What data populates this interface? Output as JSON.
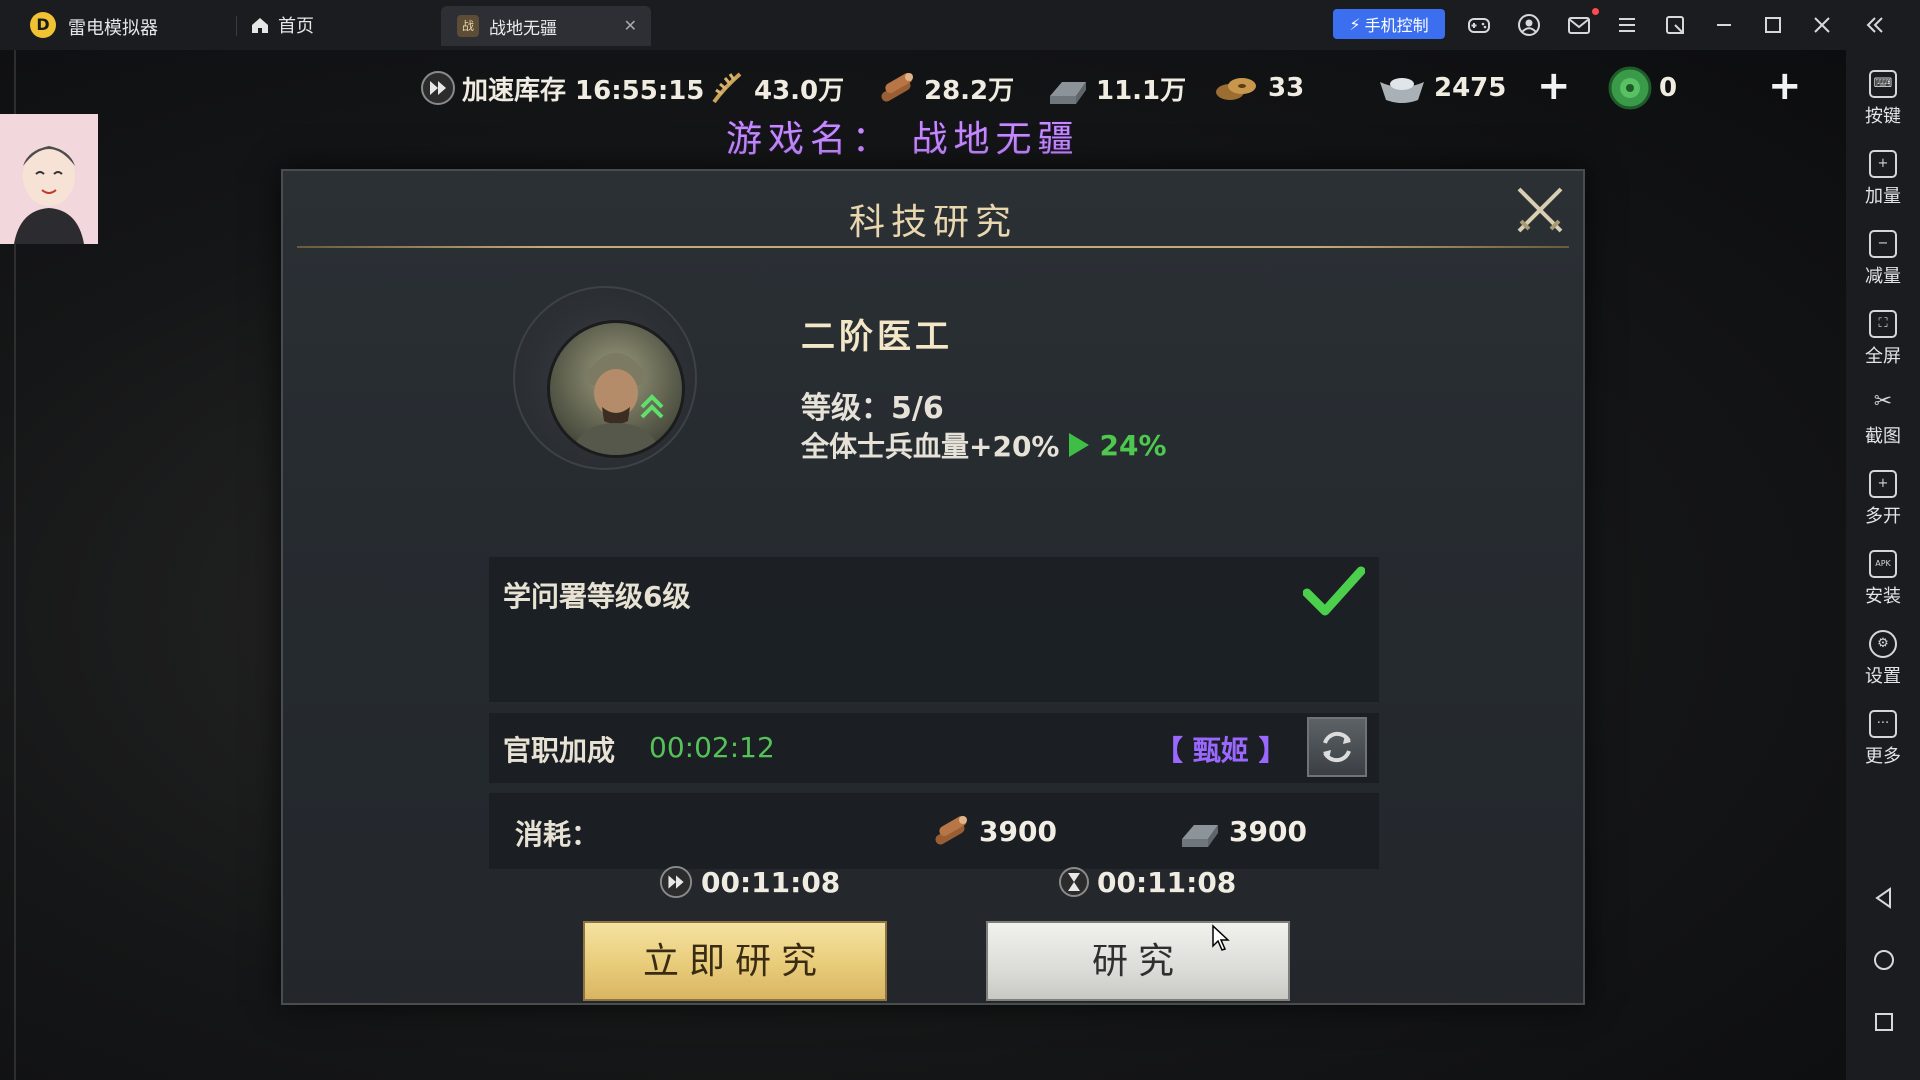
{
  "window": {
    "app_title": "雷电模拟器",
    "tabs": [
      {
        "label": "首页"
      },
      {
        "label": "战地无疆"
      }
    ],
    "phone_control_label": "手机控制"
  },
  "sidebar": {
    "items": [
      {
        "label": "按键",
        "icon": "keyboard-icon"
      },
      {
        "label": "加量",
        "icon": "volume-up-icon"
      },
      {
        "label": "减量",
        "icon": "volume-down-icon"
      },
      {
        "label": "全屏",
        "icon": "fullscreen-icon"
      },
      {
        "label": "截图",
        "icon": "scissors-icon"
      },
      {
        "label": "多开",
        "icon": "multi-instance-icon"
      },
      {
        "label": "安装",
        "icon": "apk-install-icon"
      },
      {
        "label": "设置",
        "icon": "settings-icon"
      },
      {
        "label": "更多",
        "icon": "more-icon"
      }
    ]
  },
  "resources": {
    "speedup_label": "加速库存 16:55:15",
    "food": "43.0万",
    "wood": "28.2万",
    "iron": "11.1万",
    "coin": "33",
    "silver": "2475",
    "jade": "0"
  },
  "caption": "游戏名： 战地无疆",
  "dialog": {
    "title": "科技研究",
    "tech_name": "二阶医工",
    "level": "等级：5/6",
    "effect": "全体士兵血量+20%",
    "effect_next": "24%",
    "requirement": "学问署等级6级",
    "bonus_label": "官职加成",
    "bonus_time": "00:02:12",
    "bonus_name": "【 甄姬 】",
    "cost_label": "消耗：",
    "cost_wood": "3900",
    "cost_iron": "3900",
    "instant_time": "00:11:08",
    "normal_time": "00:11:08",
    "instant_button": "立即研究",
    "research_button": "研究"
  },
  "colors": {
    "accent_blue": "#3b6ff0",
    "effect_green": "#4dc94e",
    "official_purple": "#9a68ff",
    "caption_purple": "#c48bff"
  }
}
